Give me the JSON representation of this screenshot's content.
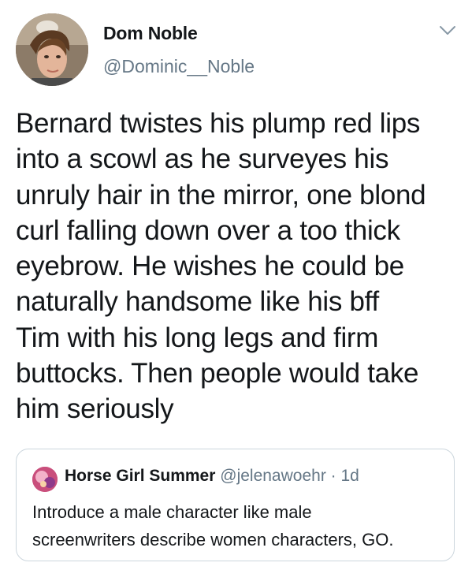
{
  "tweet": {
    "author": {
      "name": "Dom Noble",
      "handle": "@Dominic__Noble",
      "avatar_icon": "profile-photo"
    },
    "menu_icon": "chevron-down-icon",
    "text": "Bernard twistes his plump red lips\ninto a scowl as he surveyes his\nunruly hair in the mirror, one blond\ncurl falling down over a too thick\neyebrow. He wishes he could be\nnaturally handsome like his bff\nTim with his long legs and firm\nbuttocks. Then people would take\nhim seriously",
    "quoted": {
      "name": "Horse Girl Summer",
      "handle": "@jelenawoehr",
      "separator": "·",
      "time": "1d",
      "text": "Introduce a male character like male\nscreenwriters describe women characters, GO.",
      "avatar_icon": "profile-photo"
    }
  },
  "colors": {
    "primary_text": "#14171a",
    "secondary_text": "#657786",
    "border": "#ccd6dd",
    "background": "#ffffff"
  }
}
